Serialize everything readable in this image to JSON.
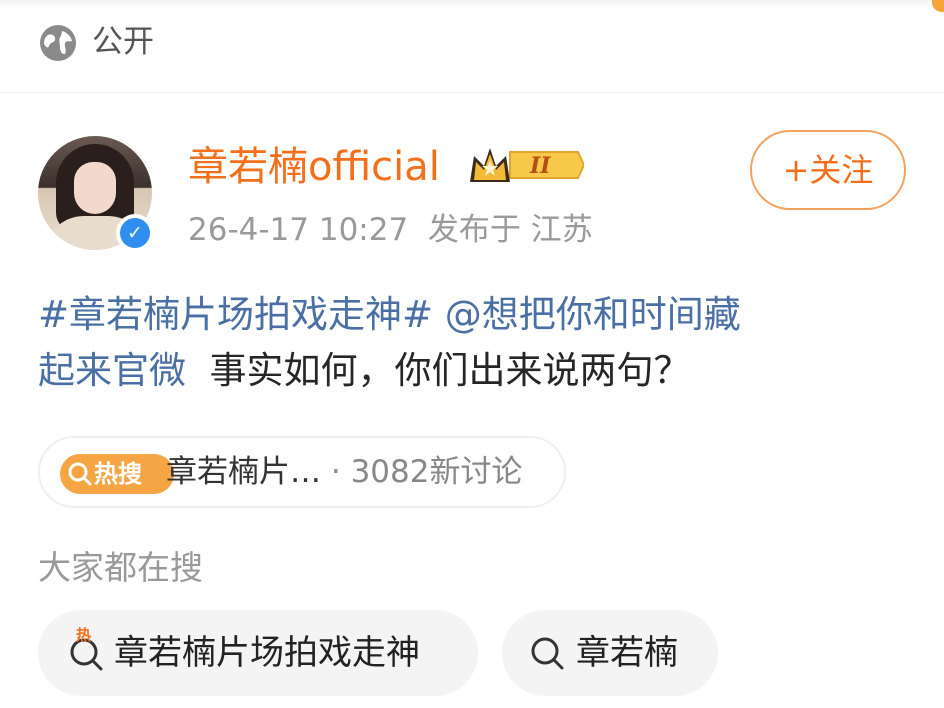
{
  "header": {
    "visibility": "公开"
  },
  "post": {
    "author": "章若楠official",
    "timestamp": "26-4-17 10:27",
    "location": "发布于 江苏",
    "follow_label": "+关注",
    "topic": "#章若楠片场拍戏走神#",
    "mention": "@想把你和时间藏起来官微",
    "text": "事实如何，你们出来说两句？"
  },
  "hot_search": {
    "badge": "热搜",
    "title": "章若楠片…",
    "separator": " · ",
    "count": "3082新讨论"
  },
  "related": {
    "title": "大家都在搜",
    "items": [
      {
        "label": "章若楠片场拍戏走神",
        "hot": "热"
      },
      {
        "label": "章若楠"
      }
    ]
  },
  "colors": {
    "accent": "#f36f1b",
    "link": "#4a6fa5",
    "badge": "#f5a544"
  }
}
